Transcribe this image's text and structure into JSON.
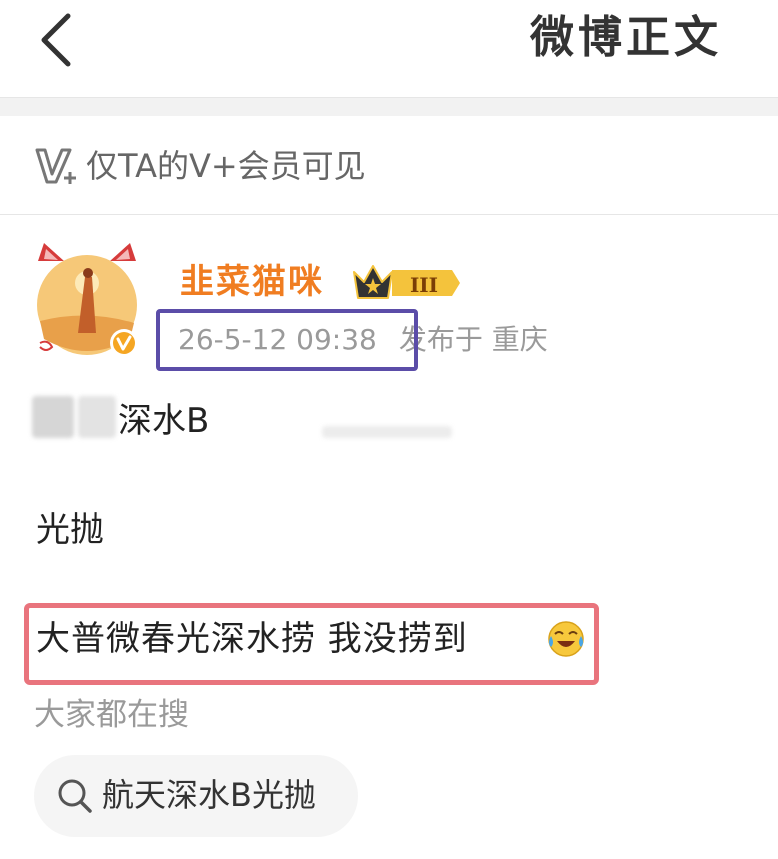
{
  "header": {
    "title": "微博正文",
    "back_icon": "chevron-left-icon"
  },
  "visibility": {
    "icon": "vplus-member-icon",
    "text": "仅TA的V+会员可见"
  },
  "post": {
    "author": "韭菜猫咪",
    "badge_icon": "crown-level-badge-icon",
    "badge_level": "III",
    "verified_icon": "verified-v-icon",
    "time": "26-5-12 09:38",
    "location": "发布于 重庆",
    "lines": [
      "深水B",
      "光抛",
      "大普微春光深水捞 我没捞到"
    ],
    "emoji": "laugh-cry-emoji-icon"
  },
  "suggestions": {
    "label": "大家都在搜",
    "chip": "航天深水B光抛",
    "chip_icon": "search-icon"
  },
  "colors": {
    "username": "#f07d21",
    "time_box": "#5b4da8",
    "highlight_box": "#e9747d",
    "muted_text": "#9a9a9a"
  }
}
